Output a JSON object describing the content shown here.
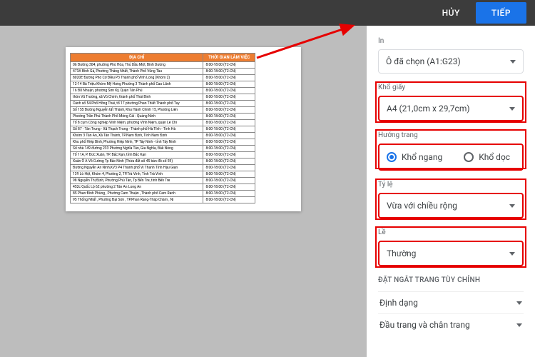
{
  "topbar": {
    "cancel": "HỦY",
    "next": "TIẾP"
  },
  "table": {
    "headers": {
      "addr": "ĐỊA CHỈ",
      "time": "THỜI GIAN LÀM VIỆC"
    },
    "rows": [
      {
        "addr": "06 Đường 304, phường Phú Hòa, Thủ Dầu Một, Bình Dương",
        "time": "8:00-18:00 (T2-CN)"
      },
      {
        "addr": "473A Bình Gá, Phường Thắng Nhất, Thành Phố Vũng Tàu",
        "time": "8:00-18:00 (T2-CN)"
      },
      {
        "addr": "8020E Đường Phó Cơ Điều P3 Thành phố Vĩnh Long (Khóm 2)",
        "time": "8:00-18:00 (T2-CN)"
      },
      {
        "addr": "12-14 Bà Triệu Khóm Mỹ Hưng Phường 3 Thành phố Cao Lãnh",
        "time": "8:00-18:00 (T2-CN)"
      },
      {
        "addr": "16 Đỗ Nhuận, phường Sơn Kỳ, Quận Tân Phú",
        "time": "8:00-18:00 (T2-CN)"
      },
      {
        "addr": "thôn Vũ Trường, xã Vũ Chính, thành phố Thái Bình",
        "time": "8:00-18:00 (T2-CN)"
      },
      {
        "addr": "Cành số 54 Phố Hồng Thái, tổ 17 phường Phan Thiết Thành phố Tuy",
        "time": "8:00-18:00 (T2-CN)"
      },
      {
        "addr": "Số 155 Đường Nguyễn tất Thành, Khu Hành Chính 15, Phường Liên",
        "time": "8:00-18:00 (T2-CN)"
      },
      {
        "addr": "Phường Trần Phú-Thành Phố Móng Cái - Quảng Ninh",
        "time": "8:00-18:00 (T2-CN)"
      },
      {
        "addr": "Tổ 8 cụm Công nghiệp Vĩnh Niệm, phường Vĩnh Niệm, quận Lê Chi",
        "time": "8:00-18:00 (T2-CN)"
      },
      {
        "addr": "Số 87 - Tân Trung - Xã Thạch Trung - Thành phố Hà Tĩnh - Tỉnh Hà",
        "time": "8:00-18:00 (T2-CN)"
      },
      {
        "addr": "Khóm 3 Tân An, Xã Tân Thành, TP.Nam Định, Tỉnh Nam Định",
        "time": "8:00-18:00 (T2-CN)"
      },
      {
        "addr": "Khu phố Hiệp Bình, Phường Hiệp Ninh, TP Tây Ninh - tỉnh Tây Ninh",
        "time": "8:00-18:00 (T2-CN)"
      },
      {
        "addr": "Số nhà 149 đường 233 Phường Nghĩa Tân, Gia Nghĩa, Đắk Nông",
        "time": "8:00-18:00 (T2-CN)"
      },
      {
        "addr": "Tổ 11A, P. Đức Xuân, TP. Bắc Kạn, tỉnh Bắc Kạn",
        "time": "8:00-18:00 (T2-CN)"
      },
      {
        "addr": "Xuân Ổ A Võ Cường Tp Bắc Ninh (Thửa đất số 45 bản đồ số 59)",
        "time": "8:00-18:00 (T2-CN)"
      },
      {
        "addr": "Đường Nguyễn An Ninh,KV3 P4 Thành phố Vị Thanh Tỉnh Hậu Gian",
        "time": "8:00-18:00 (T2-CN)"
      },
      {
        "addr": "139 Lò Hột, Khóm 4, Phường 2, TP.Trà Vinh, Tỉnh Trà Vinh",
        "time": "8:00-18:00 (T2-CN)"
      },
      {
        "addr": "98 Nguyễn Thị Định, Phường Phú Tân, Tp Bến Tre, tỉnh Bến Tre",
        "time": "8:00-18:00 (T2-CN)"
      },
      {
        "addr": "452c Quốc Lộ 62 phường 2 Tân An Long An",
        "time": "8:00-18:00 (T2-CN)"
      },
      {
        "addr": "85 Phan Đình Phùng , Phường Cam Thuận , Thành phố Cam Ranh",
        "time": "8:00-18:00 (T2-CN)"
      },
      {
        "addr": "95 Thống Nhất , Phường Đại Sơn , TP.Phan Rang-Tháp Chàm , Ni",
        "time": "8:00-18:00 (T2-CN)"
      }
    ]
  },
  "sidebar": {
    "print_label": "In",
    "print_value": "Ô đã chọn (A1:G23)",
    "paper_label": "Khổ giấy",
    "paper_value": "A4 (21,0cm x 29,7cm)",
    "orient_label": "Hướng trang",
    "orient_landscape": "Khổ ngang",
    "orient_portrait": "Khổ dọc",
    "scale_label": "Tỷ lệ",
    "scale_value": "Vừa với chiều rộng",
    "margin_label": "Lề",
    "margin_value": "Thường",
    "custom_breaks": "ĐẶT NGẮT TRANG TÙY CHỈNH",
    "format": "Định dạng",
    "headerfooter": "Đầu trang và chân trang"
  }
}
